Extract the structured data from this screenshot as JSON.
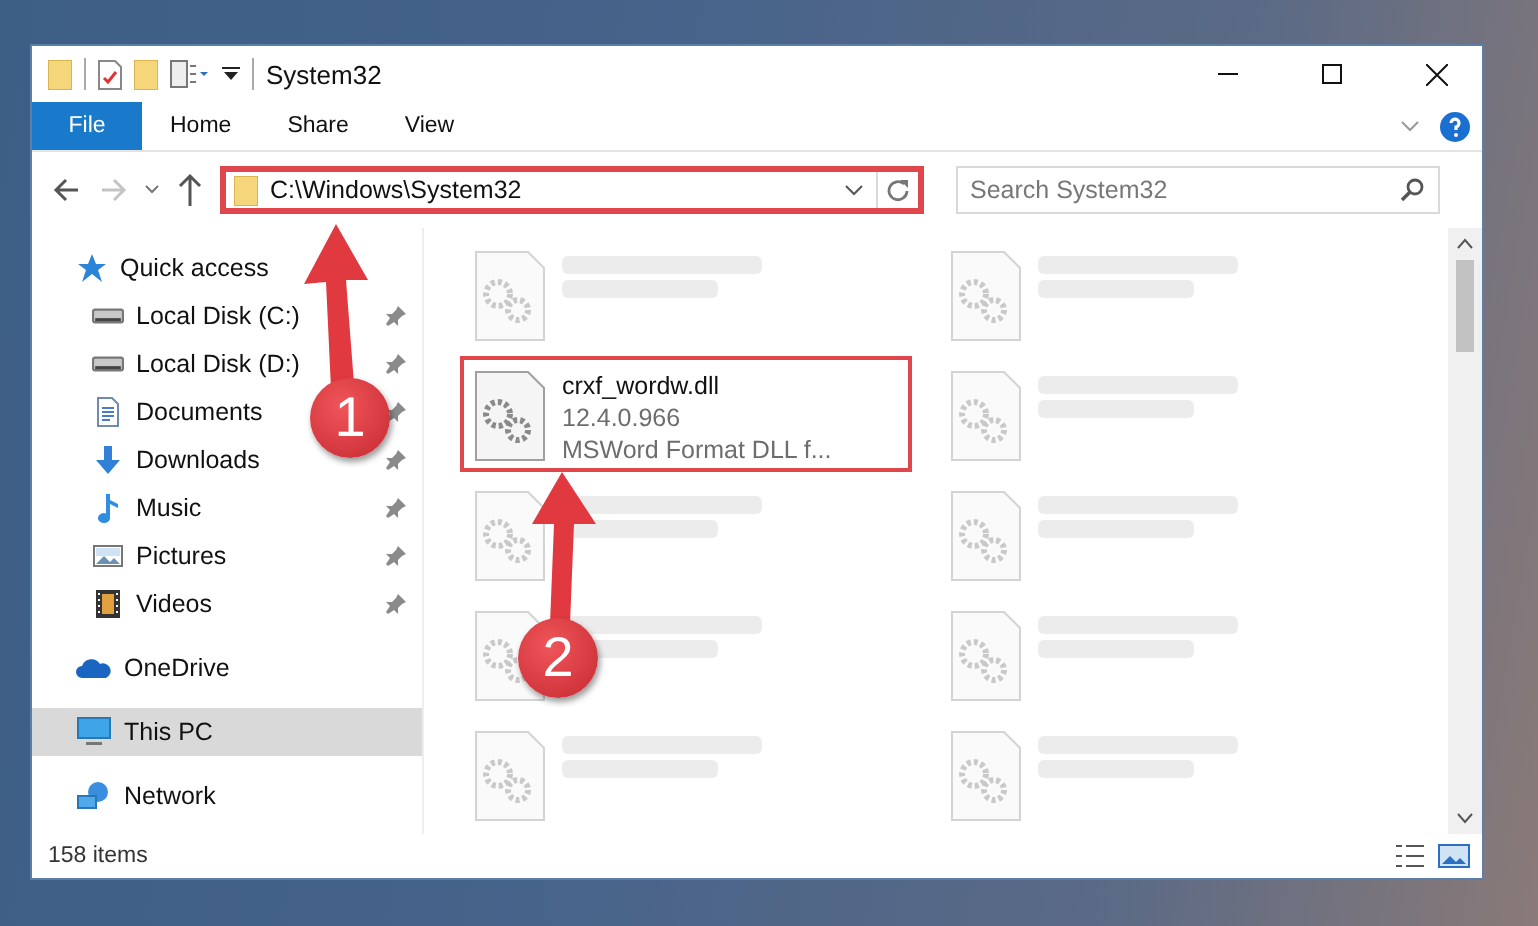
{
  "window": {
    "title": "System32"
  },
  "ribbon_tabs": [
    {
      "label": "File",
      "kind": "file"
    },
    {
      "label": "Home",
      "kind": "tab"
    },
    {
      "label": "Share",
      "kind": "tab"
    },
    {
      "label": "View",
      "kind": "tab"
    }
  ],
  "address": {
    "path": "C:\\Windows\\System32",
    "highlighted": true
  },
  "search": {
    "placeholder": "Search System32"
  },
  "sidebar": {
    "items": [
      {
        "label": "Quick access",
        "kind": "star",
        "selected": false,
        "children": [
          {
            "label": "Local Disk (C:)",
            "kind": "disk",
            "pinned": true,
            "selected": false
          },
          {
            "label": "Local Disk (D:)",
            "kind": "disk",
            "pinned": true,
            "selected": false
          },
          {
            "label": "Documents",
            "kind": "documents",
            "pinned": true,
            "selected": false
          },
          {
            "label": "Downloads",
            "kind": "downloads",
            "pinned": true,
            "selected": false
          },
          {
            "label": "Music",
            "kind": "music",
            "pinned": true,
            "selected": false
          },
          {
            "label": "Pictures",
            "kind": "pictures",
            "pinned": true,
            "selected": false
          },
          {
            "label": "Videos",
            "kind": "videos",
            "pinned": true,
            "selected": false
          }
        ]
      },
      {
        "label": "OneDrive",
        "kind": "cloud",
        "selected": false
      },
      {
        "label": "This PC",
        "kind": "pc",
        "selected": true
      },
      {
        "label": "Network",
        "kind": "network",
        "selected": false
      }
    ]
  },
  "files": [
    {
      "blurred": true
    },
    {
      "blurred": true
    },
    {
      "name": "crxf_wordw.dll",
      "lines": [
        "12.4.0.966",
        "MSWord Format DLL f..."
      ],
      "blurred": false,
      "highlighted": true
    },
    {
      "blurred": true
    },
    {
      "blurred": true
    },
    {
      "blurred": true
    },
    {
      "blurred": true
    },
    {
      "blurred": true
    },
    {
      "blurred": true
    },
    {
      "blurred": true
    }
  ],
  "status_bar": {
    "item_count": "158 items"
  },
  "annotations": [
    {
      "number": "1"
    },
    {
      "number": "2"
    }
  ]
}
